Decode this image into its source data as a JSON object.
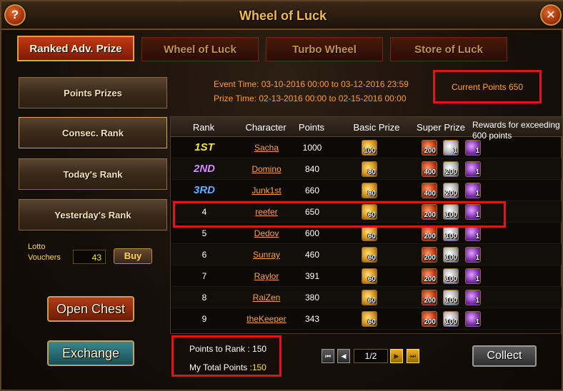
{
  "window": {
    "title": "Wheel of Luck",
    "help_glyph": "?",
    "close_glyph": "✕"
  },
  "tabs": [
    {
      "label": "Ranked Adv. Prize",
      "active": true
    },
    {
      "label": "Wheel of Luck",
      "active": false
    },
    {
      "label": "Turbo Wheel",
      "active": false
    },
    {
      "label": "Store of Luck",
      "active": false
    }
  ],
  "sidebar": {
    "items": [
      {
        "label": "Points Prizes"
      },
      {
        "label": "Consec. Rank"
      },
      {
        "label": "Today's Rank"
      },
      {
        "label": "Yesterday's Rank"
      }
    ],
    "lotto_label_line1": "Lotto",
    "lotto_label_line2": "Vouchers",
    "lotto_value": "43",
    "buy_label": "Buy",
    "open_chest_label": "Open Chest",
    "exchange_label": "Exchange"
  },
  "info": {
    "event_time": "Event Time: 03-10-2016 00:00 to 03-12-2016 23:59",
    "prize_time": "Prize Time: 02-13-2016 00:00 to 02-15-2016 00:00",
    "current_points": "Current Points 650"
  },
  "table": {
    "headers": {
      "rank": "Rank",
      "character": "Character",
      "points": "Points",
      "basic": "Basic Prize",
      "super": "Super Prize",
      "rewards": "Rewards for exceeding 600 points"
    },
    "rows": [
      {
        "rank": "1ST",
        "character": "Sacha",
        "points": "1000",
        "basic": "100",
        "s1": "200",
        "s2": "1",
        "s3": "1"
      },
      {
        "rank": "2ND",
        "character": "Domino",
        "points": "840",
        "basic": "80",
        "s1": "400",
        "s2": "200",
        "s3": "1"
      },
      {
        "rank": "3RD",
        "character": "Junk1st",
        "points": "660",
        "basic": "80",
        "s1": "400",
        "s2": "200",
        "s3": "1"
      },
      {
        "rank": "4",
        "character": "reefer",
        "points": "650",
        "basic": "60",
        "s1": "200",
        "s2": "100",
        "s3": "1"
      },
      {
        "rank": "5",
        "character": "Dedov",
        "points": "600",
        "basic": "60",
        "s1": "200",
        "s2": "100",
        "s3": "1"
      },
      {
        "rank": "6",
        "character": "Sunray",
        "points": "460",
        "basic": "60",
        "s1": "200",
        "s2": "100",
        "s3": "1"
      },
      {
        "rank": "7",
        "character": "Raylor",
        "points": "391",
        "basic": "60",
        "s1": "200",
        "s2": "100",
        "s3": "1"
      },
      {
        "rank": "8",
        "character": "RaiZen",
        "points": "380",
        "basic": "60",
        "s1": "200",
        "s2": "100",
        "s3": "1"
      },
      {
        "rank": "9",
        "character": "theKeeper",
        "points": "343",
        "basic": "60",
        "s1": "200",
        "s2": "100",
        "s3": "1"
      }
    ]
  },
  "footer": {
    "points_to_rank": "Points to Rank : 150",
    "my_total_label": "My Total Points :",
    "my_total_value": "150",
    "page": "1/2",
    "collect_label": "Collect"
  },
  "colors": {
    "highlight_border": "#e0141c",
    "orange_text": "#ffa23e",
    "gold_text": "#ffd84a",
    "active_tab": "#c23a12"
  },
  "icons": {
    "help": "help-icon",
    "close": "close-icon",
    "basic_prize": "gold-coin-icon",
    "super_prize_1": "red-gem-icon",
    "super_prize_2": "silver-coin-icon",
    "super_prize_3": "purple-chest-icon"
  }
}
